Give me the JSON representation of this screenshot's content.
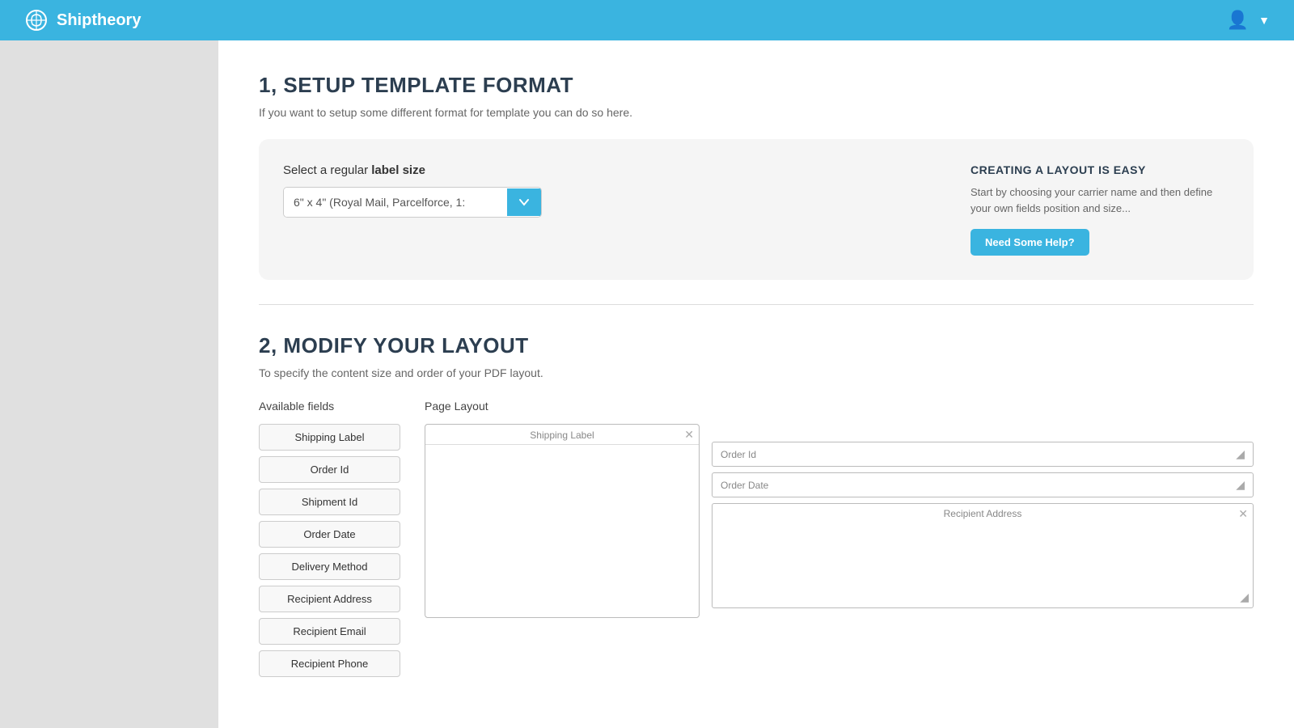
{
  "header": {
    "logo_text": "Shiptheory",
    "user_icon": "👤",
    "chevron": "▼"
  },
  "section1": {
    "title": "1, SETUP TEMPLATE FORMAT",
    "description": "If you want to setup some different format for template you can do so here.",
    "select_label_prefix": "Select a regular ",
    "select_label_bold": "label size",
    "select_value": "6\" x 4\" (Royal Mail, Parcelforce, 1:",
    "help_title": "CREATING A LAYOUT IS EASY",
    "help_text": "Start by choosing your carrier name and then define your own fields position and size...",
    "help_button": "Need Some Help?"
  },
  "section2": {
    "title": "2, MODIFY YOUR LAYOUT",
    "description": "To specify the content size and order of your PDF layout.",
    "available_fields_label": "Available fields",
    "page_layout_label": "Page Layout",
    "available_fields": [
      "Shipping Label",
      "Order Id",
      "Shipment Id",
      "Order Date",
      "Delivery Method",
      "Recipient Address",
      "Recipient Email",
      "Recipient Phone"
    ],
    "shipping_label_box_title": "Shipping Label",
    "layout_fields": [
      {
        "label": "Order Id"
      },
      {
        "label": "Order Date"
      }
    ],
    "recipient_address_label": "Recipient Address"
  }
}
